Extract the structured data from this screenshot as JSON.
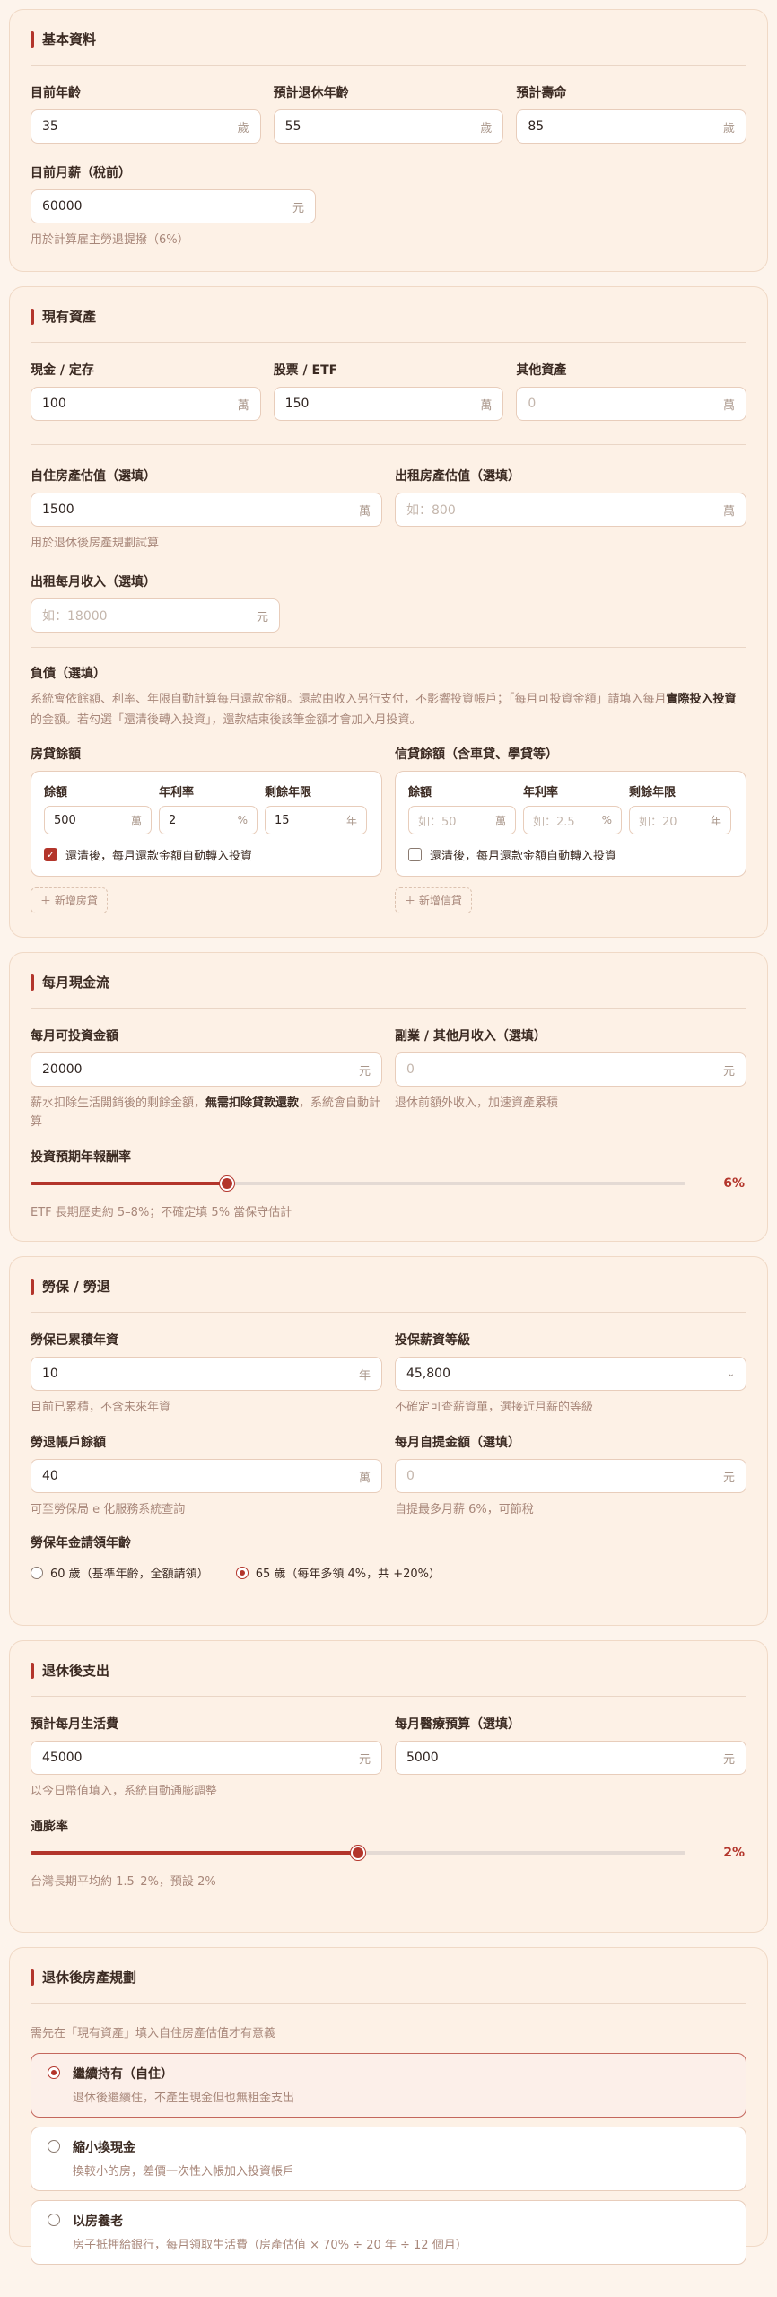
{
  "basic": {
    "title": "基本資料",
    "current_age": {
      "label": "目前年齡",
      "value": "35",
      "unit": "歲"
    },
    "retire_age": {
      "label": "預計退休年齡",
      "value": "55",
      "unit": "歲"
    },
    "life_expectancy": {
      "label": "預計壽命",
      "value": "85",
      "unit": "歲"
    },
    "salary": {
      "label": "目前月薪（稅前）",
      "value": "60000",
      "unit": "元",
      "hint": "用於計算雇主勞退提撥（6%）"
    }
  },
  "assets": {
    "title": "現有資產",
    "cash": {
      "label": "現金 / 定存",
      "value": "100",
      "unit": "萬"
    },
    "stocks": {
      "label": "股票 / ETF",
      "value": "150",
      "unit": "萬"
    },
    "other": {
      "label": "其他資產",
      "placeholder": "0",
      "unit": "萬"
    },
    "home": {
      "label": "自住房產估值（選填）",
      "value": "1500",
      "unit": "萬",
      "hint": "用於退休後房產規劃試算"
    },
    "rental": {
      "label": "出租房產估值（選填）",
      "placeholder": "如：800",
      "unit": "萬"
    },
    "rent_income": {
      "label": "出租每月收入（選填）",
      "placeholder": "如：18000",
      "unit": "元"
    },
    "debt": {
      "title": "負債（選填）",
      "desc1": "系統會依餘額、利率、年限自動計算每月還款金額。還款由收入另行支付，不影響投資帳戶；「每月可投資金額」請填入",
      "desc2a": "每月",
      "desc2b": "實際投入投資",
      "desc2c": "的金額。若勾選「還清後轉入投資」，還款結束後該筆金額才會加入月投資。",
      "mortgage": {
        "title": "房貸餘額",
        "balance_label": "餘額",
        "balance_value": "500",
        "balance_unit": "萬",
        "rate_label": "年利率",
        "rate_value": "2",
        "rate_unit": "%",
        "years_label": "剩餘年限",
        "years_value": "15",
        "years_unit": "年",
        "check_label": "還清後，每月還款金額自動轉入投資",
        "add_label": "＋ 新增房貸"
      },
      "loan": {
        "title": "信貸餘額（含車貸、學貸等）",
        "balance_label": "餘額",
        "balance_placeholder": "如：50",
        "balance_unit": "萬",
        "rate_label": "年利率",
        "rate_placeholder": "如：2.5",
        "rate_unit": "%",
        "years_label": "剩餘年限",
        "years_placeholder": "如：20",
        "years_unit": "年",
        "check_label": "還清後，每月還款金額自動轉入投資",
        "add_label": "＋ 新增信貸"
      }
    }
  },
  "cashflow": {
    "title": "每月現金流",
    "invest": {
      "label": "每月可投資金額",
      "value": "20000",
      "unit": "元",
      "hint_a": "薪水扣除生活開銷後的剩餘金額，",
      "hint_b": "無需扣除貸款還款",
      "hint_c": "，系統會自動計算"
    },
    "side": {
      "label": "副業 / 其他月收入（選填）",
      "placeholder": "0",
      "unit": "元",
      "hint": "退休前額外收入，加速資產累積"
    },
    "return_rate": {
      "label": "投資預期年報酬率",
      "value": 6,
      "display": "6%",
      "min": 0,
      "max": 20,
      "hint": "ETF 長期歷史約 5–8%；不確定填 5% 當保守估計"
    }
  },
  "labor": {
    "title": "勞保 / 勞退",
    "years": {
      "label": "勞保已累積年資",
      "value": "10",
      "unit": "年",
      "hint": "目前已累積，不含未來年資"
    },
    "grade": {
      "label": "投保薪資等級",
      "value": "45,800",
      "hint": "不確定可查薪資單，選接近月薪的等級"
    },
    "pension_balance": {
      "label": "勞退帳戶餘額",
      "value": "40",
      "unit": "萬",
      "hint": "可至勞保局 e 化服務系統查詢"
    },
    "voluntary": {
      "label": "每月自提金額（選填）",
      "placeholder": "0",
      "unit": "元",
      "hint": "自提最多月薪 6%，可節稅"
    },
    "claim_age": {
      "label": "勞保年金請領年齡",
      "option1": "60 歲（基準年齡，全額請領）",
      "option2": "65 歲（每年多領 4%，共 +20%）",
      "selected": 2
    }
  },
  "expenses": {
    "title": "退休後支出",
    "living": {
      "label": "預計每月生活費",
      "value": "45000",
      "unit": "元",
      "hint": "以今日幣值填入，系統自動通膨調整"
    },
    "medical": {
      "label": "每月醫療預算（選填）",
      "value": "5000",
      "unit": "元"
    },
    "inflation": {
      "label": "通膨率",
      "value": 2,
      "display": "2%",
      "min": 0,
      "max": 4,
      "hint": "台灣長期平均約 1.5–2%，預設 2%"
    }
  },
  "property": {
    "title": "退休後房產規劃",
    "note": "需先在「現有資產」填入自住房產估值才有意義",
    "options": [
      {
        "title": "繼續持有（自住）",
        "desc": "退休後繼續住，不產生現金但也無租金支出"
      },
      {
        "title": "縮小換現金",
        "desc": "換較小的房，差價一次性入帳加入投資帳戶"
      },
      {
        "title": "以房養老",
        "desc": "房子抵押給銀行，每月領取生活費（房產估值 × 70% ÷ 20 年 ÷ 12 個月）"
      }
    ],
    "selected": 0
  },
  "colors": {
    "accent": "#b3352b",
    "card_bg": "#fdf1e6",
    "page_bg": "#fdf4ec"
  }
}
